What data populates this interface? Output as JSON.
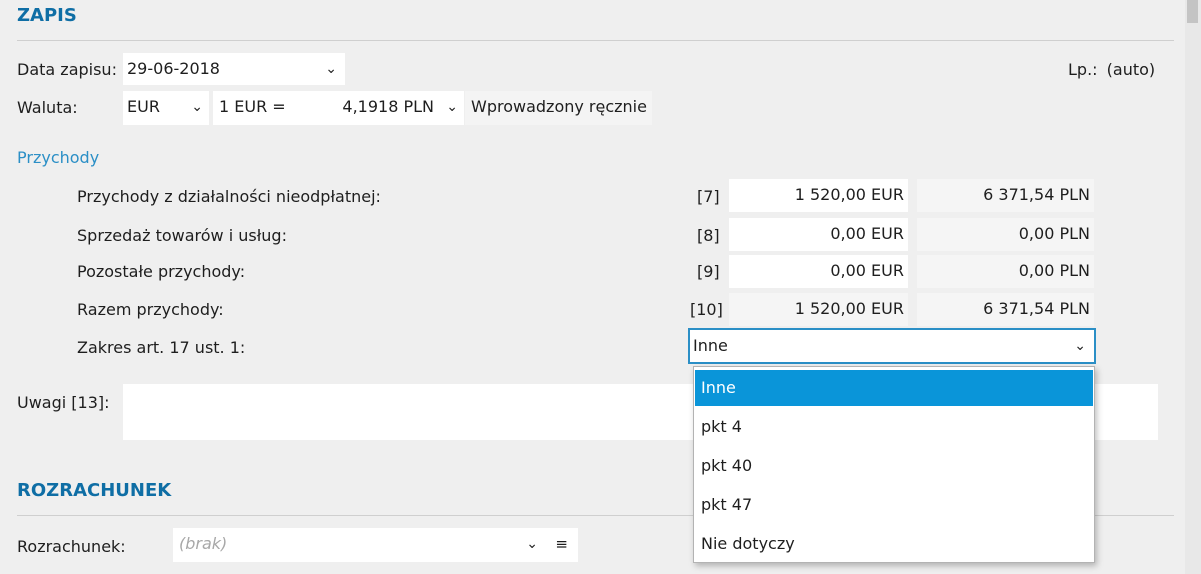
{
  "zapis": {
    "title": "ZAPIS",
    "data_label": "Data zapisu:",
    "data_value": "29-06-2018",
    "lp_label": "Lp.:",
    "lp_value": "(auto)",
    "waluta_label": "Waluta:",
    "waluta_value": "EUR",
    "rate_prefix": "1 EUR =",
    "rate_value": "4,1918 PLN",
    "rate_mode": "Wprowadzony ręcznie"
  },
  "przychody": {
    "title": "Przychody",
    "rows": [
      {
        "label": "Przychody z działalności nieodpłatnej:",
        "code": "[7]",
        "eur": "1 520,00 EUR",
        "pln": "6 371,54 PLN"
      },
      {
        "label": "Sprzedaż towarów i usług:",
        "code": "[8]",
        "eur": "0,00 EUR",
        "pln": "0,00 PLN"
      },
      {
        "label": "Pozostałe przychody:",
        "code": "[9]",
        "eur": "0,00 EUR",
        "pln": "0,00 PLN"
      },
      {
        "label": "Razem przychody:",
        "code": "[10]",
        "eur": "1 520,00 EUR",
        "pln": "6 371,54 PLN"
      }
    ],
    "zakres_label": "Zakres art. 17 ust. 1:",
    "zakres_value": "Inne",
    "zakres_options": [
      "Inne",
      "pkt 4",
      "pkt 40",
      "pkt 47",
      "Nie dotyczy"
    ]
  },
  "uwagi": {
    "label": "Uwagi [13]:",
    "value": ""
  },
  "rozrachunek": {
    "title": "ROZRACHUNEK",
    "label": "Rozrachunek:",
    "placeholder": "(brak)"
  },
  "icons": {
    "chevron": "chevron-down-icon",
    "menu": "menu-icon"
  },
  "colors": {
    "accent": "#0f6ea5",
    "selected": "#0a95d9"
  }
}
